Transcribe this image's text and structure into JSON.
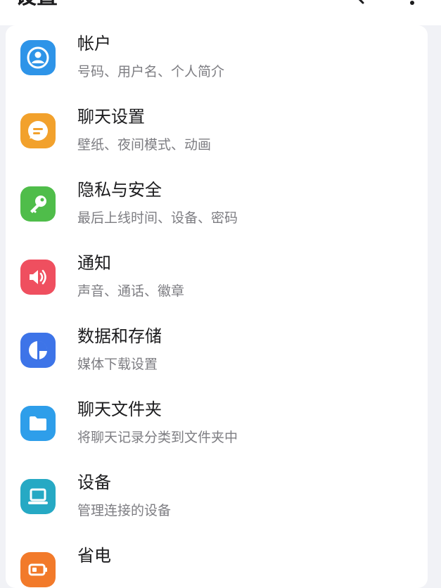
{
  "header": {
    "title": "设置"
  },
  "items": [
    {
      "title": "帐户",
      "subtitle": "号码、用户名、个人简介",
      "color": "#2e94e8"
    },
    {
      "title": "聊天设置",
      "subtitle": "壁纸、夜间模式、动画",
      "color": "#f2a12c"
    },
    {
      "title": "隐私与安全",
      "subtitle": "最后上线时间、设备、密码",
      "color": "#4fbd4a"
    },
    {
      "title": "通知",
      "subtitle": "声音、通话、徽章",
      "color": "#ef4f5f"
    },
    {
      "title": "数据和存储",
      "subtitle": "媒体下载设置",
      "color": "#3d74e8"
    },
    {
      "title": "聊天文件夹",
      "subtitle": "将聊天记录分类到文件夹中",
      "color": "#2e9eea"
    },
    {
      "title": "设备",
      "subtitle": "管理连接的设备",
      "color": "#26a9c4"
    },
    {
      "title": "省电",
      "subtitle": "",
      "color": "#f27a2a"
    }
  ]
}
